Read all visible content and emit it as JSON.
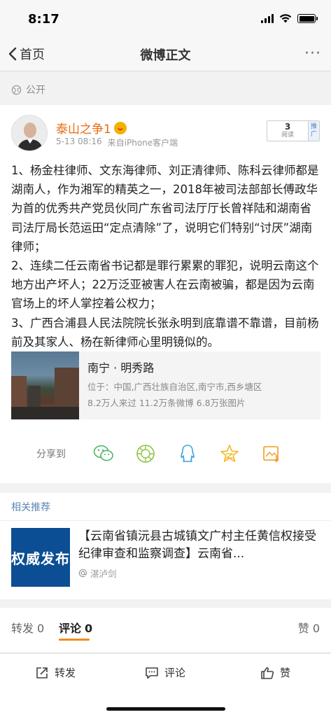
{
  "status_bar": {
    "time": "8:17"
  },
  "nav": {
    "back_label": "首页",
    "title": "微博正文",
    "more_label": "···"
  },
  "visibility": {
    "label": "公开"
  },
  "post": {
    "author": "泰山之争1",
    "time": "5-13 08:16",
    "source": "来自iPhone客户端",
    "read_count": "3",
    "read_label": "阅读",
    "promote_label": "推广",
    "body": "1、杨金柱律师、文东海律师、刘正清律师、陈科云律师都是湖南人，作为湘军的精英之一，2018年被司法部部长傅政华为首的优秀共产党员伙同广东省司法厅厅长曾祥陆和湖南省司法厅局长范运田“定点清除”了，说明它们特别“讨厌”湖南律师；\n2、连续二任云南省书记都是罪行累累的罪犯，说明云南这个地方出产坏人；22万泛亚被害人在云南被骗，都是因为云南官场上的坏人掌控着公权力；\n3、广西合浦县人民法院院长张永明到底靠谱不靠谱，目前杨前及其家人、杨在新律师心里明镜似的。",
    "location": {
      "title": "南宁 · 明秀路",
      "address": "位于：中国,广西壮族自治区,南宁市,西乡塘区",
      "stats": "8.2万人来过 11.2万条微博 6.8万张图片"
    },
    "share_label": "分享到",
    "share_targets": [
      "wechat-icon",
      "moments-icon",
      "qq-icon",
      "qzone-icon",
      "save-image-icon"
    ]
  },
  "related": {
    "header": "相关推荐",
    "item": {
      "thumb_text": "权威发布",
      "title": "【云南省镇沅县古城镇文广村主任黄信权接受纪律审查和监察调查】云南省...",
      "source": "湛泸剑"
    }
  },
  "tabs": {
    "repost": {
      "label": "转发",
      "count": "0"
    },
    "comment": {
      "label": "评论",
      "count": "0"
    },
    "like": {
      "label": "赞",
      "count": "0"
    }
  },
  "actions": {
    "repost": "转发",
    "comment": "评论",
    "like": "赞"
  },
  "colors": {
    "accent": "#f28a1f",
    "username": "#e86b0e",
    "link": "#5b87b6"
  }
}
